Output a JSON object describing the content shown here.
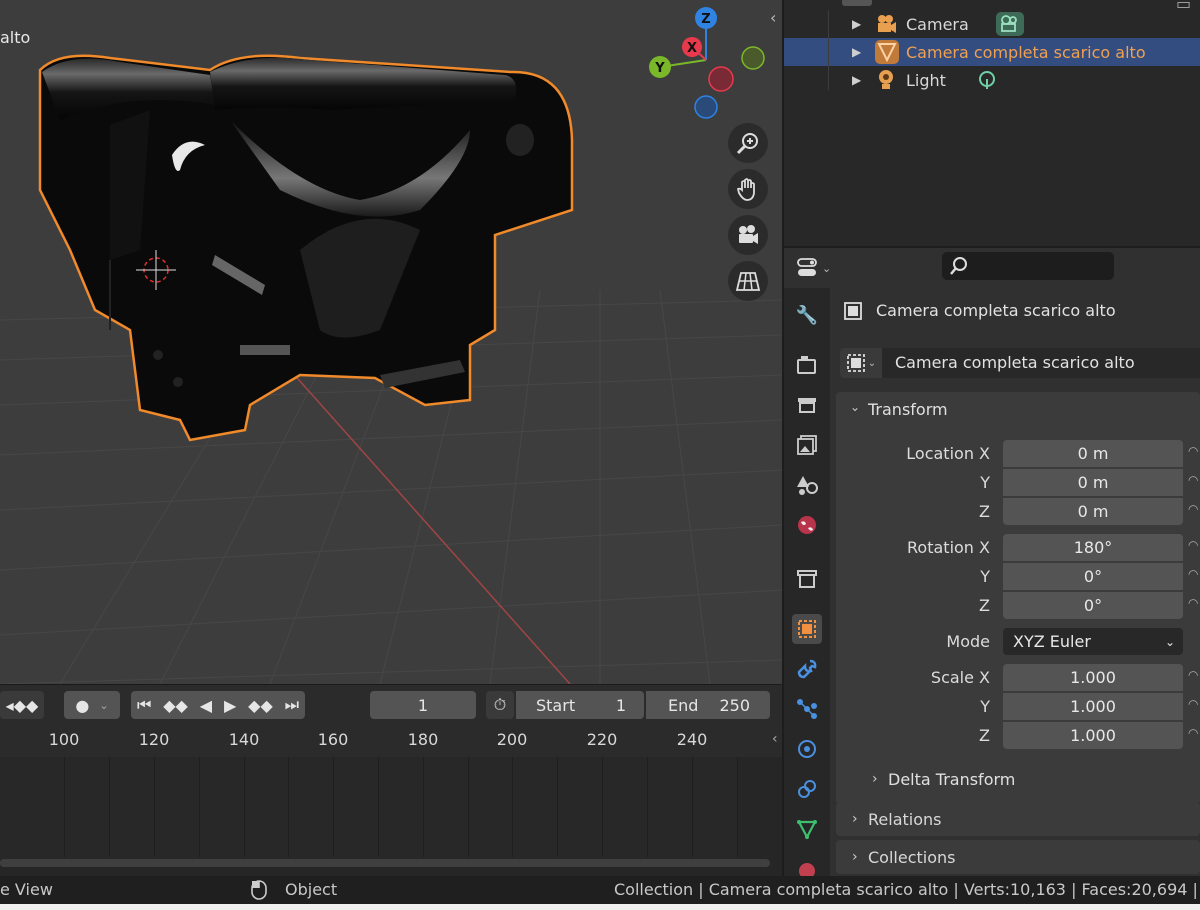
{
  "viewport": {
    "object_label": "alto",
    "gizmo": {
      "z": "Z",
      "y": "Y",
      "x": "X"
    }
  },
  "outliner": {
    "items": [
      {
        "label": "Camera",
        "type": "camera",
        "selected": false
      },
      {
        "label": "Camera completa scarico alto",
        "type": "mesh",
        "selected": true
      },
      {
        "label": "Light",
        "type": "light",
        "selected": false
      }
    ]
  },
  "timeline": {
    "current_frame": "1",
    "start_label": "Start",
    "start_value": "1",
    "end_label": "End",
    "end_value": "250",
    "ticks": [
      "100",
      "120",
      "140",
      "160",
      "180",
      "200",
      "220",
      "240"
    ]
  },
  "properties": {
    "object_name": "Camera completa scarico alto",
    "datablock_name": "Camera completa scarico alto",
    "transform": {
      "title": "Transform",
      "location_label": "Location X",
      "location": [
        "0 m",
        "0 m",
        "0 m"
      ],
      "rotation_label": "Rotation X",
      "rotation": [
        "180°",
        "0°",
        "0°"
      ],
      "mode_label": "Mode",
      "mode_value": "XYZ Euler",
      "scale_label": "Scale X",
      "scale": [
        "1.000",
        "1.000",
        "1.000"
      ],
      "axis_y": "Y",
      "axis_z": "Z"
    },
    "delta_transform": "Delta Transform",
    "relations": "Relations",
    "collections": "Collections"
  },
  "statusbar": {
    "left": "e View",
    "mode": "Object",
    "info": "Collection | Camera completa scarico alto | Verts:10,163 | Faces:20,694 |"
  },
  "colors": {
    "selection": "#334d80",
    "active_text": "#f0a050",
    "outline": "#f08a2a",
    "gizmo_x": "#e8394d",
    "gizmo_y": "#7ab829",
    "gizmo_z": "#2f83e3"
  }
}
